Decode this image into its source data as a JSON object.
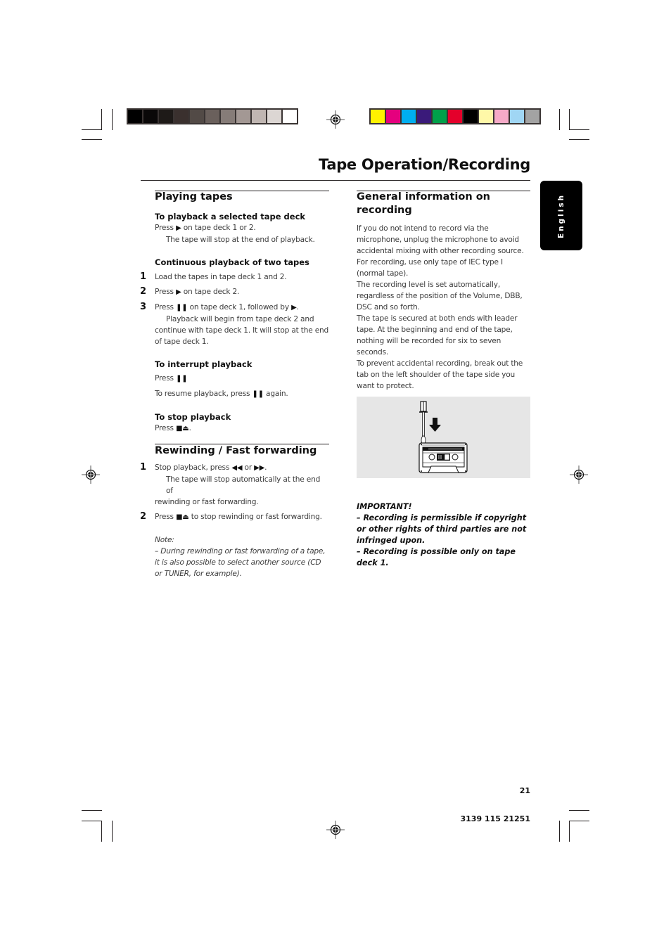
{
  "header": {
    "title": "Tape Operation/Recording",
    "language_tab": "English"
  },
  "color_bars": {
    "grayscale": [
      "#000000",
      "#0a0808",
      "#1e1a18",
      "#3a302e",
      "#524a46",
      "#6a605c",
      "#867c78",
      "#a39894",
      "#c0b6b2",
      "#dcd6d3",
      "#ffffff"
    ],
    "process": [
      "#fff200",
      "#e5007e",
      "#00aeef",
      "#3a1a7a",
      "#00a04a",
      "#e4002b",
      "#000000",
      "#fff8a8",
      "#f6aac8",
      "#a0d6f4",
      "#a3a3a3"
    ]
  },
  "left_column": {
    "playing": {
      "heading": "Playing tapes",
      "selected": {
        "subheading": "To playback a selected tape deck",
        "line1_pre": "Press",
        "line1_glyph": "▶",
        "line1_post": " on tape deck 1 or 2.",
        "line2": "The tape will stop at the end of playback."
      },
      "continuous": {
        "subheading": "Continuous playback of two tapes",
        "steps": [
          {
            "num": "1",
            "text": "Load the tapes in tape deck 1 and 2."
          },
          {
            "num": "2",
            "pre": "Press",
            "glyph": "▶",
            "post": "on tape deck 2."
          },
          {
            "num": "3",
            "pre": "Press",
            "glyph": "❚❚",
            "mid": "on tape deck 1, followed by",
            "glyph2": "▶",
            "post": ".",
            "note_first": "Playback will begin from tape deck 2 and",
            "note_rest": "continue with tape deck 1.  It will stop at the end of tape deck 1."
          }
        ]
      },
      "interrupt": {
        "subheading": "To interrupt playback",
        "line1_pre": "Press",
        "line1_glyph": "❚❚",
        "line2_pre": "To resume playback, press",
        "line2_glyph": "❚❚",
        "line2_post": "again."
      },
      "stop": {
        "subheading": "To stop playback",
        "line_pre": "Press",
        "line_glyph": "■⏏",
        "line_post": "."
      }
    },
    "rewinding": {
      "heading": "Rewinding / Fast forwarding",
      "steps": [
        {
          "num": "1",
          "pre": "Stop playback, press",
          "glyph": "◀◀",
          "mid": "or",
          "glyph2": "▶▶",
          "post": ".",
          "note_first": "The tape will stop automatically at the end of",
          "note_rest": "rewinding or fast forwarding."
        },
        {
          "num": "2",
          "pre": "Press",
          "glyph": "■⏏",
          "post": "to stop rewinding or fast forwarding."
        }
      ],
      "note_label": "Note:",
      "note_text": "–  During rewinding or fast forwarding of a tape, it is also possible to select another source (CD or TUNER, for example)."
    }
  },
  "right_column": {
    "heading": "General information on recording",
    "paragraphs": [
      "If you do not intend to record via the microphone, unplug the microphone to avoid accidental mixing with other recording source.",
      "For recording, use only tape of IEC type I (normal tape).",
      "The recording level is set automatically, regardless of the position of the Volume, DBB, DSC and so forth.",
      "The tape is secured at both ends with leader tape.  At the beginning and end of the tape, nothing will be recorded for six to seven seconds.",
      "To prevent accidental recording, break out the tab on the left shoulder of the tape side you want to protect."
    ],
    "illustration": "cassette-tab-removal-illustration",
    "important": {
      "label": "IMPORTANT!",
      "items": [
        "–  Recording is permissible if copyright or other rights of third parties are not infringed upon.",
        "–  Recording is possible only on tape deck 1."
      ]
    }
  },
  "footer": {
    "page_number": "21",
    "part_number": "3139 115 21251"
  }
}
